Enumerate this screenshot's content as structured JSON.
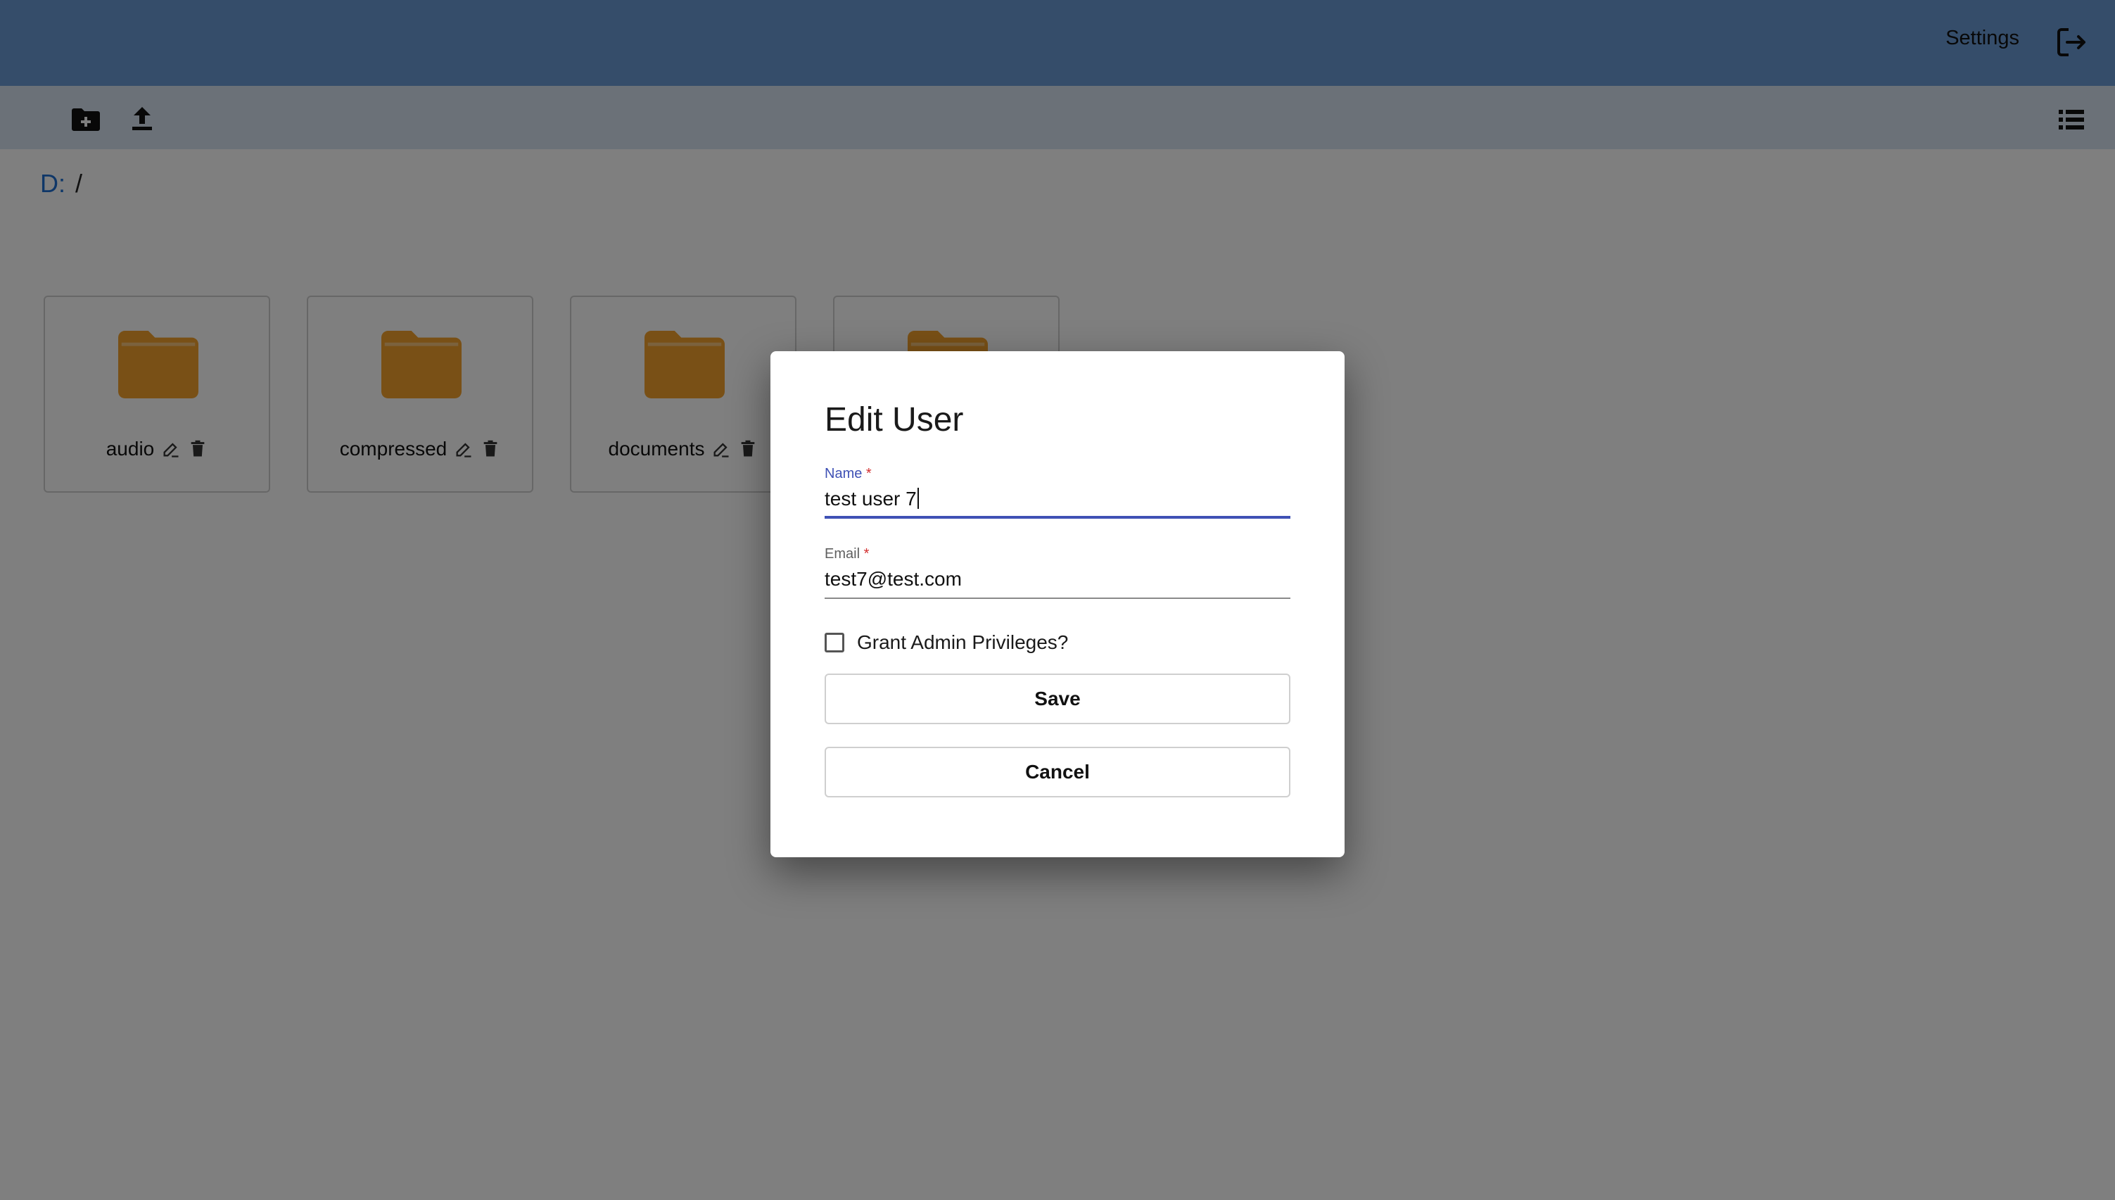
{
  "header": {
    "settings_label": "Settings"
  },
  "breadcrumb": {
    "drive": "D:",
    "separator": "/"
  },
  "folders": [
    {
      "name": "audio"
    },
    {
      "name": "compressed"
    },
    {
      "name": "documents"
    },
    {
      "name": ""
    }
  ],
  "dialog": {
    "title": "Edit User",
    "name_label": "Name",
    "name_value": "test user 7",
    "email_label": "Email",
    "email_value": "test7@test.com",
    "required_marker": "*",
    "admin_label": "Grant Admin Privileges?",
    "admin_checked": false,
    "save_label": "Save",
    "cancel_label": "Cancel"
  },
  "colors": {
    "appbar": "#6a9ad4",
    "folder": "#f2a12c",
    "focus": "#3f51b5"
  }
}
